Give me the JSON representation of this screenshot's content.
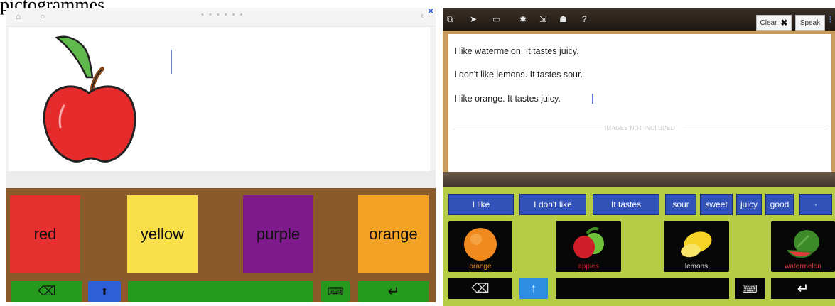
{
  "caption": "pictogrammes.",
  "left_app": {
    "toolbar": {
      "home_icon": "home-icon",
      "settings_icon": "gear-icon",
      "page_dots": "• • • • • •",
      "back_icon": "‹",
      "close_icon": "×"
    },
    "cards": [
      {
        "label": "red",
        "color": "#e53030"
      },
      {
        "label": "yellow",
        "color": "#f9e04a"
      },
      {
        "label": "purple",
        "color": "#7e1a8c"
      },
      {
        "label": "orange",
        "color": "#f4a223"
      }
    ],
    "controls": {
      "delete_glyph": "⌫",
      "shift_glyph": "⬆",
      "keyboard_glyph": "⌨",
      "return_glyph": "↵"
    }
  },
  "right_app": {
    "toolbar": {
      "icons": [
        "share-icon",
        "forward-icon",
        "keyboard-icon",
        "gear-icon",
        "export-icon",
        "people-icon",
        "help-icon"
      ],
      "clear_label": "Clear",
      "speak_label": "Speak"
    },
    "lines": [
      "I like watermelon.  It tastes juicy.",
      "I don't like lemons.  It tastes sour.",
      "I like orange.  It tastes juicy."
    ],
    "phrases": [
      "I like",
      "I don't like",
      "It tastes",
      "sour",
      "sweet",
      "juicy",
      "good"
    ],
    "pictures": [
      {
        "label": "orange"
      },
      {
        "label": "apples"
      },
      {
        "label": "lemons"
      },
      {
        "label": "watermelon"
      }
    ],
    "controls": {
      "delete_glyph": "⌫",
      "shift_glyph": "↑",
      "keyboard_glyph": "⌨",
      "return_glyph": "↵"
    }
  }
}
